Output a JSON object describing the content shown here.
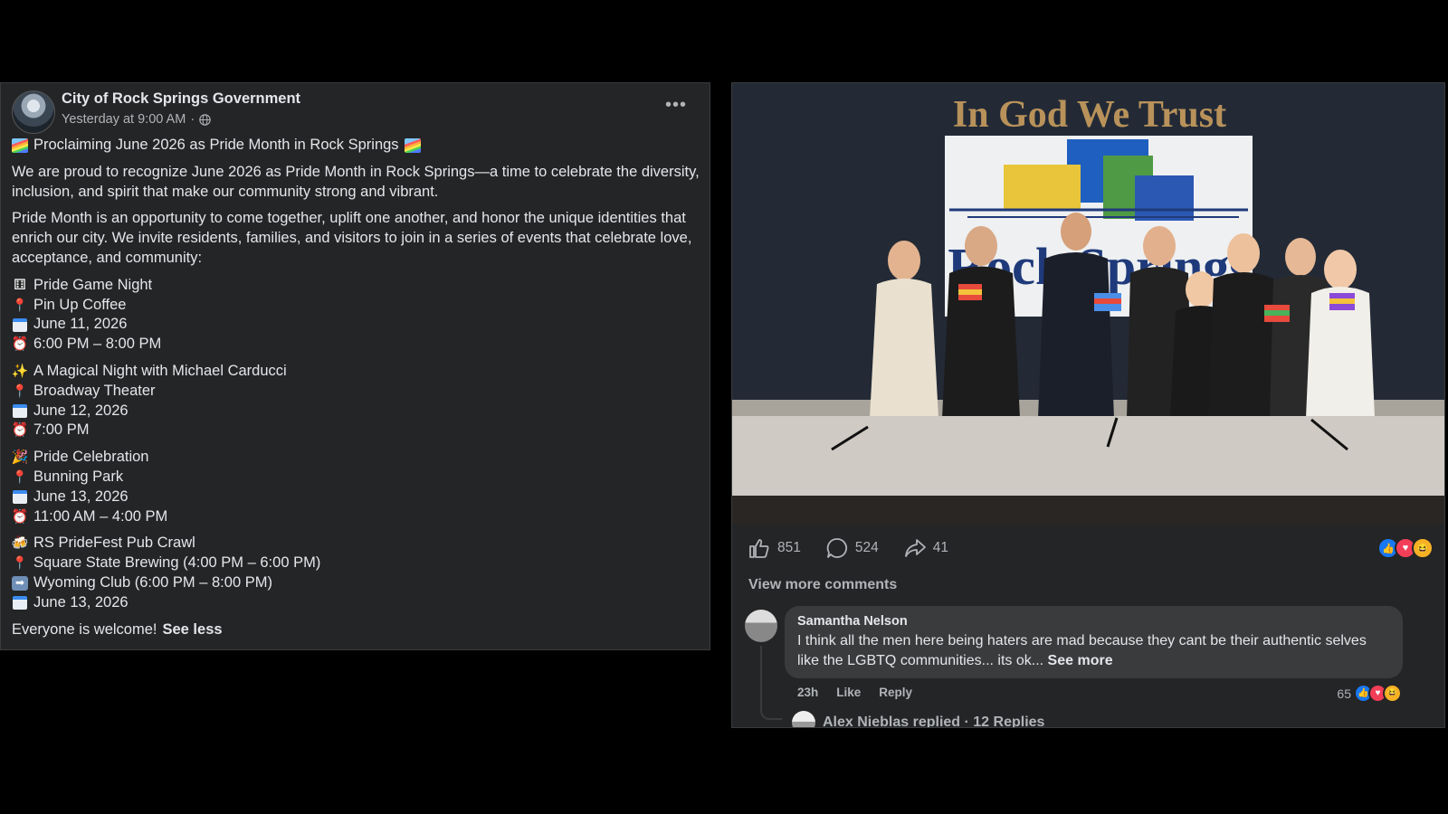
{
  "post": {
    "page_name": "City of Rock Springs Government",
    "timestamp": "Yesterday at 9:00 AM",
    "separator": "·",
    "more_label": "•••",
    "headline": "Proclaiming June 2026 as Pride Month in Rock Springs",
    "paragraph1": "We are proud to recognize June 2026 as Pride Month in Rock Springs—a time to celebrate the diversity, inclusion, and spirit that make our community strong and vibrant.",
    "paragraph2": "Pride Month is an opportunity to come together, uplift one another, and honor the unique identities that enrich our city. We invite residents, families, and visitors to join in a series of events that celebrate love, acceptance, and community:",
    "events": [
      {
        "title": "Pride Game Night",
        "location": "Pin Up Coffee",
        "date": "June 11, 2026",
        "time": "6:00 PM – 8:00 PM"
      },
      {
        "title": "A Magical Night with Michael Carducci",
        "location": "Broadway Theater",
        "date": "June 12, 2026",
        "time": "7:00 PM"
      },
      {
        "title": "Pride Celebration",
        "location": "Bunning Park",
        "date": "June 13, 2026",
        "time": "11:00 AM – 4:00 PM"
      },
      {
        "title": "RS PrideFest Pub Crawl",
        "location": "Square State Brewing (4:00 PM – 6:00 PM)",
        "location2": "Wyoming Club (6:00 PM – 8:00 PM)",
        "date": "June 13, 2026"
      }
    ],
    "closing": "Everyone is welcome!",
    "see_less": "See less"
  },
  "icons": {
    "rainbow": "rainbow-flag-icon",
    "dice": "game-die-icon",
    "pin": "round-pushpin-icon",
    "calendar": "calendar-icon",
    "alarm": "alarm-clock-icon",
    "sparkles": "sparkles-icon",
    "party": "party-popper-icon",
    "beer": "beer-mugs-icon",
    "arrow": "right-arrow-icon"
  },
  "photo": {
    "motto": "In God We Trust",
    "sign_text": "Rock Springs"
  },
  "engagement": {
    "likes": "851",
    "comments": "524",
    "shares": "41"
  },
  "comments": {
    "view_more": "View more comments",
    "items": [
      {
        "author": "Samantha Nelson",
        "text": "I think all the men here being haters are mad because they cant be their authentic selves like the LGBTQ communities... its ok...",
        "see_more": "See more",
        "age": "23h",
        "like": "Like",
        "reply": "Reply",
        "reaction_count": "65",
        "replies_text": "Alex Nieblas replied · 12 Replies"
      }
    ]
  },
  "colors": {
    "panel": "#242526",
    "text": "#e4e6eb",
    "muted": "#b0b3b8",
    "like_blue": "#1877f2",
    "love_red": "#f33e58",
    "haha_yellow": "#f7b125"
  }
}
